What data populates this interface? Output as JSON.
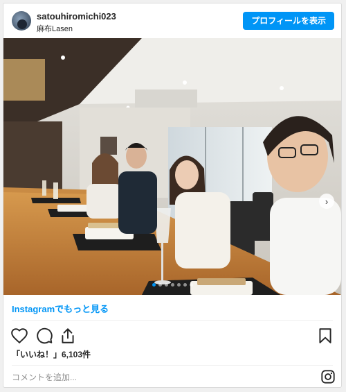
{
  "header": {
    "username": "satouhiromichi023",
    "location": "麻布Lasen",
    "profile_button": "プロフィールを表示"
  },
  "post": {
    "image_alt": "restaurant counter group photo",
    "carousel_dots": 7,
    "active_dot": 0
  },
  "links": {
    "more_on_instagram": "Instagramでもっと見る"
  },
  "engagement": {
    "likes": "「いいね！」6,103件"
  },
  "comment": {
    "placeholder": "コメントを追加..."
  },
  "colors": {
    "accent": "#0095f6",
    "text": "#262626",
    "muted": "#8e8e8e"
  },
  "icons": [
    "heart-icon",
    "comment-icon",
    "share-icon",
    "bookmark-icon",
    "instagram-logo-icon",
    "chevron-right-icon"
  ]
}
